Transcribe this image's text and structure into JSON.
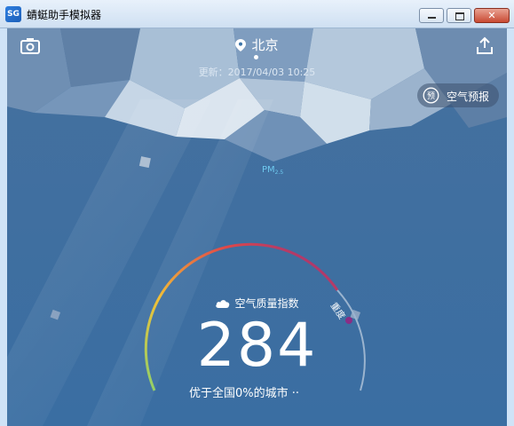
{
  "window": {
    "title": "蜻蜓助手模拟器",
    "icon_text": "SG",
    "close_glyph": "✕"
  },
  "header": {
    "city": "北京",
    "updated": "更新：2017/04/03 10:25",
    "forecast_label": "空气预报",
    "forecast_icon_text": "预"
  },
  "pollutant": {
    "name": "PM",
    "sub": "2.5"
  },
  "aqi": {
    "title": "空气质量指数",
    "value": "284",
    "level": "重度",
    "rank_text": "优于全国0%的城市 ··"
  },
  "colors": {
    "accent_blue": "#3a6ea2",
    "gauge_green": "#8fd16a",
    "gauge_yellow": "#f2c037",
    "gauge_red": "#e04848",
    "gauge_purple": "#8a2d86",
    "pm_label": "#6ec9ef"
  },
  "icons": {
    "camera": "camera-icon",
    "share": "share-icon",
    "location": "location-pin-icon",
    "weather": "cloud-icon",
    "forecast": "forecast-icon"
  }
}
